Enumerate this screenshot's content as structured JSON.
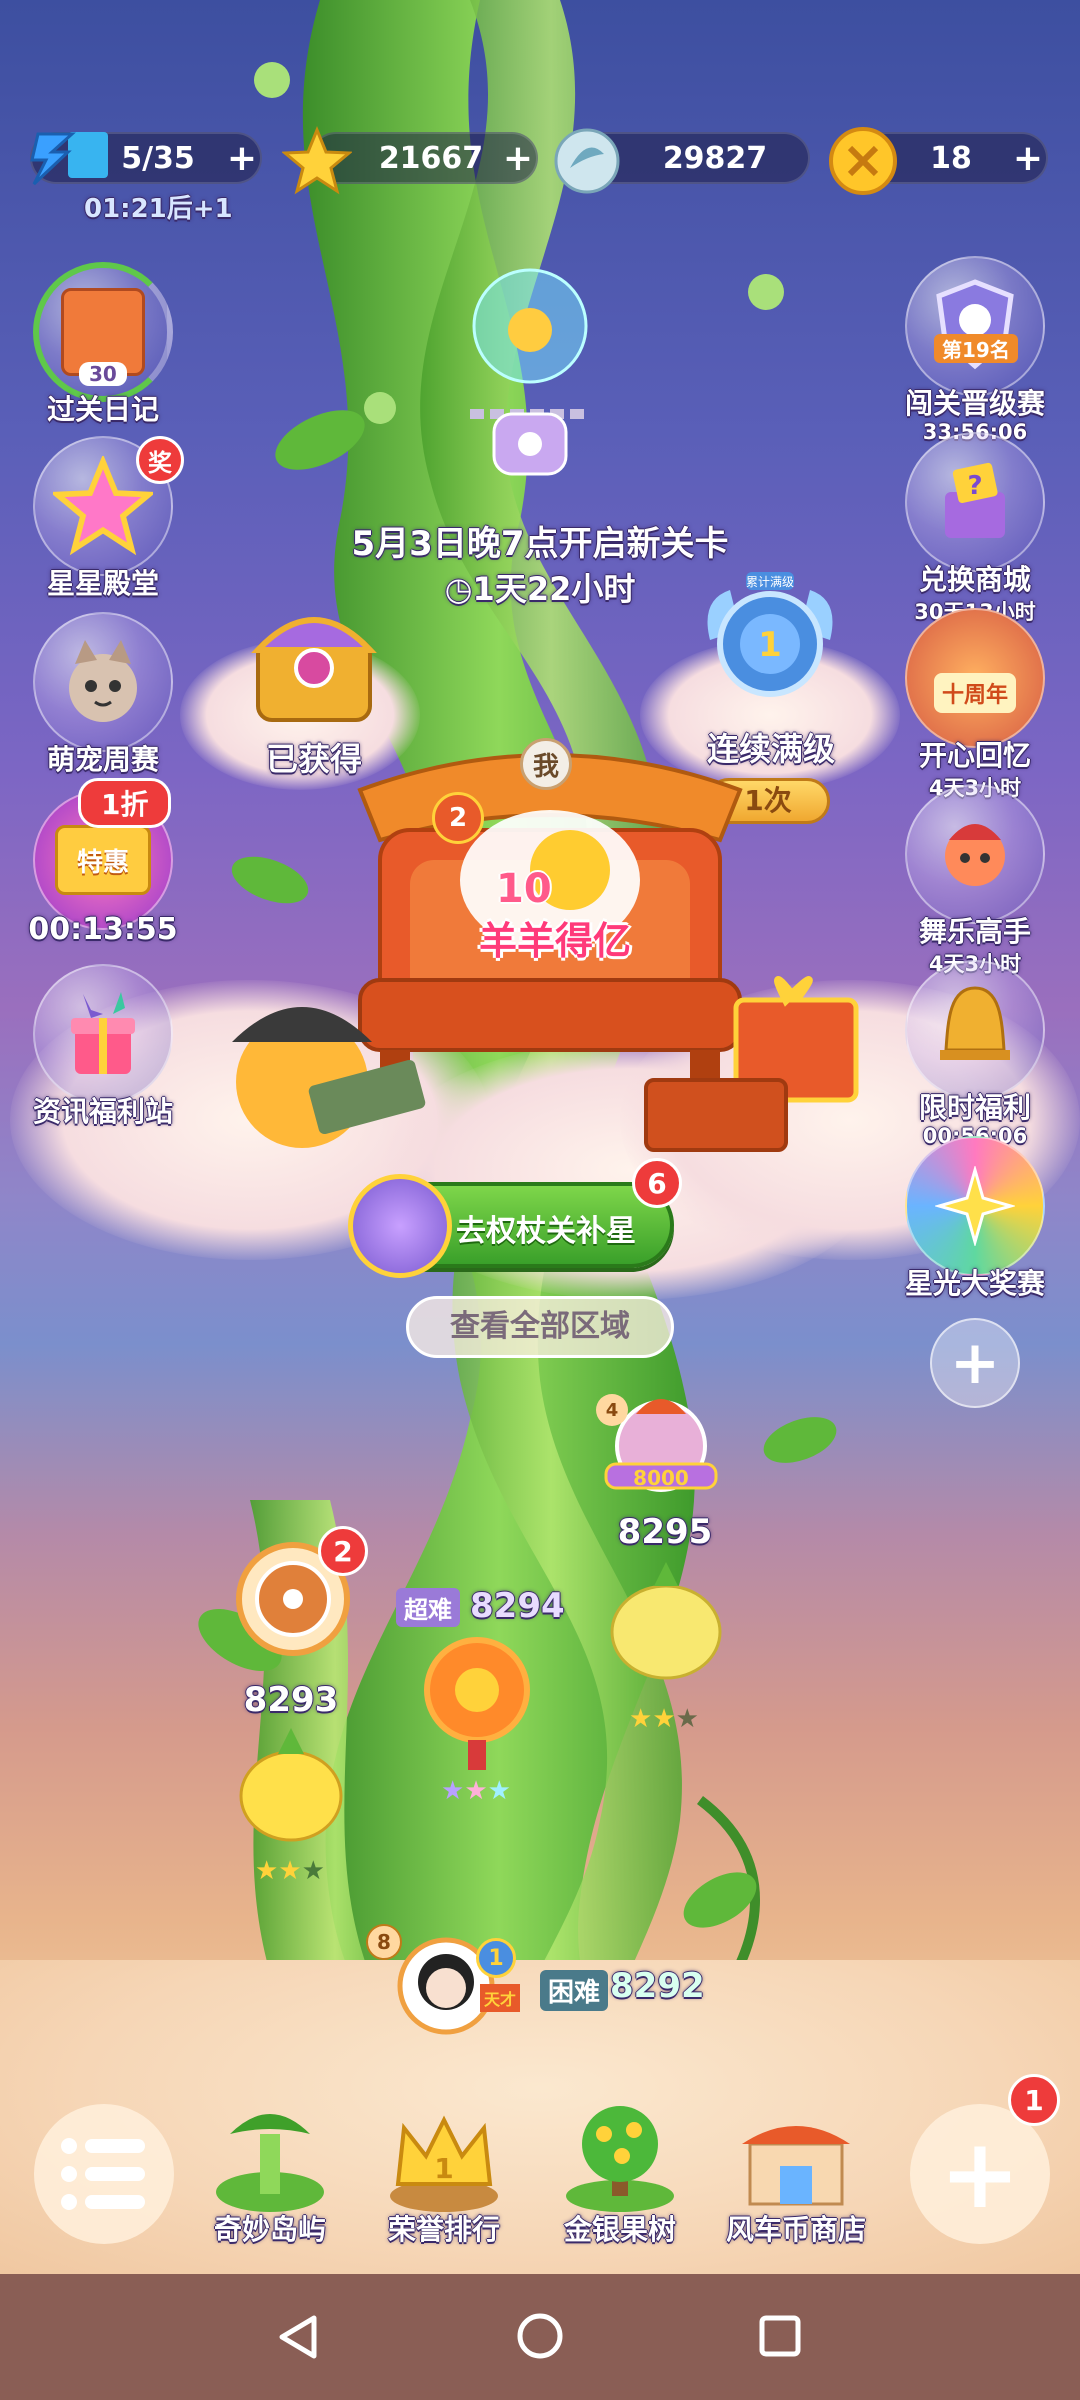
{
  "top_bar": {
    "energy": {
      "value": "5/35",
      "plus": "+",
      "timer": "01:21后+1"
    },
    "stars": {
      "value": "21667",
      "plus": "+"
    },
    "gems": {
      "value": "29827"
    },
    "coins": {
      "value": "18",
      "plus": "+"
    }
  },
  "left_menu": [
    {
      "label": "过关日记",
      "badge": "30"
    },
    {
      "label": "星星殿堂",
      "badge": "奖"
    },
    {
      "label": "萌宠周赛"
    },
    {
      "label": "特惠",
      "badge": "1折",
      "timer": "00:13:55"
    },
    {
      "label": "资讯福利站"
    }
  ],
  "right_menu": [
    {
      "label": "闯关晋级赛",
      "rank": "第19名",
      "timer": "33:56:06"
    },
    {
      "label": "兑换商城",
      "timer": "30天13小时"
    },
    {
      "label": "开心回忆",
      "tag": "十周年",
      "timer": "4天3小时"
    },
    {
      "label": "舞乐高手",
      "timer": "4天3小时"
    },
    {
      "label": "限时福利",
      "timer": "00:56:06"
    },
    {
      "label": "星光大奖赛"
    },
    {
      "label": "+"
    }
  ],
  "locked_stage": {
    "notice": "5月3日晚7点开启新关卡",
    "countdown": "1天22小时"
  },
  "obtained": {
    "label": "已获得"
  },
  "streak": {
    "label": "连续满级",
    "count": "1次",
    "level": "1",
    "tag": "累计满级"
  },
  "throne": {
    "me": "我",
    "rank": "2",
    "title": "羊羊得亿",
    "num": "10"
  },
  "scepter": {
    "label": "去权杖关补星",
    "badge": "6"
  },
  "view_all": {
    "label": "查看全部区域"
  },
  "levels": [
    {
      "id": "8295",
      "stars": 2,
      "pet_badge": "4",
      "score": "8000"
    },
    {
      "id": "8294",
      "tag": "超难",
      "stars": 3
    },
    {
      "id": "8293",
      "stars": 2,
      "badge": "2"
    },
    {
      "id": "8292",
      "tag": "困难",
      "avatar_badge": "8",
      "medal": "1",
      "title": "天才"
    }
  ],
  "bottom_nav": [
    {
      "label": "奇妙岛屿"
    },
    {
      "label": "荣誉排行"
    },
    {
      "label": "金银果树"
    },
    {
      "label": "风车币商店"
    }
  ],
  "fab": {
    "plus": "+",
    "badge": "1"
  },
  "colors": {
    "gold": "#ffd23a",
    "green": "#4cb83a",
    "red": "#ee3b3b",
    "purple": "#7a5ad0"
  }
}
